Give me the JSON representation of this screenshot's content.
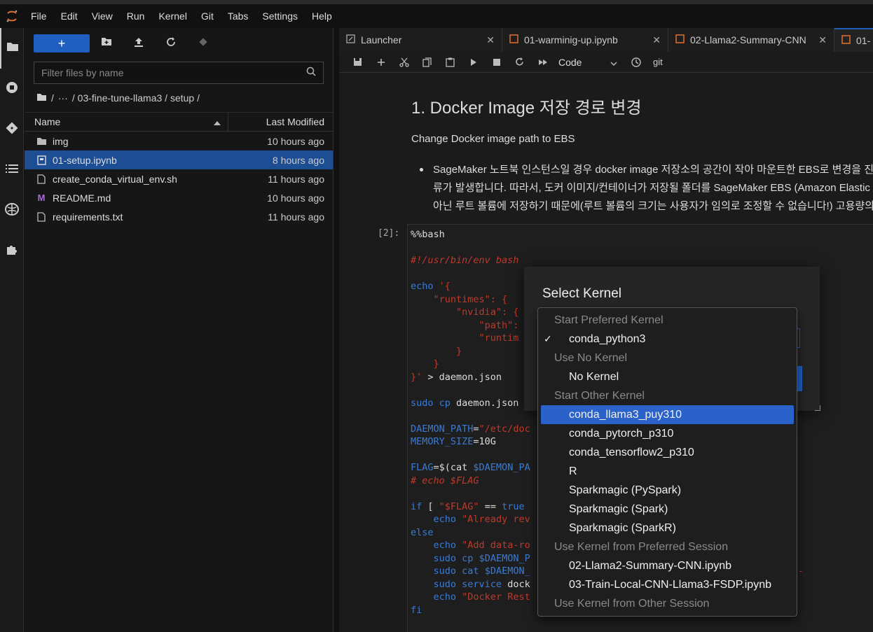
{
  "menubar": {
    "items": [
      "File",
      "Edit",
      "View",
      "Run",
      "Kernel",
      "Git",
      "Tabs",
      "Settings",
      "Help"
    ]
  },
  "filebrowser": {
    "new_label": "+",
    "filter_placeholder": "Filter files by name",
    "breadcrumb": {
      "root": "/",
      "ellipsis": "···",
      "path": "/ 03-fine-tune-llama3 / setup /"
    },
    "columns": {
      "name": "Name",
      "modified": "Last Modified"
    },
    "files": [
      {
        "name": "img",
        "modified": "10 hours ago",
        "icon": "folder-icon"
      },
      {
        "name": "01-setup.ipynb",
        "modified": "8 hours ago",
        "icon": "notebook-icon",
        "selected": true
      },
      {
        "name": "create_conda_virtual_env.sh",
        "modified": "11 hours ago",
        "icon": "file-icon"
      },
      {
        "name": "README.md",
        "modified": "10 hours ago",
        "icon": "markdown-icon"
      },
      {
        "name": "requirements.txt",
        "modified": "11 hours ago",
        "icon": "file-icon"
      }
    ]
  },
  "tabs": [
    {
      "label": "Launcher"
    },
    {
      "label": "01-warminig-up.ipynb"
    },
    {
      "label": "02-Llama2-Summary-CNN"
    },
    {
      "label": "01-"
    }
  ],
  "notebook": {
    "cell_type": "Code",
    "git_label": "git",
    "title": "1. Docker Image 저장 경로 변경",
    "subtitle": "Change Docker image path to EBS",
    "bullet_lines": [
      "SageMaker 노트북 인스턴스일 경우 docker image 저장소의 공간이 작아 마운트한 EBS로 변경을 진행",
      "류가 발생합니다. 따라서, 도커 이미지/컨테이너가 저장될 폴더를 SageMaker EBS (Amazon Elastic B",
      "아닌 루트 볼륨에 저장하기 때문에(루트 볼륨의 크기는 사용자가 임의로 조정할 수 없습니다!) 고용량의 이"
    ],
    "prompt": "[2]:"
  },
  "dialog": {
    "title": "Select Kernel"
  },
  "kernel_dropdown": {
    "groups": [
      {
        "label": "Start Preferred Kernel",
        "options": [
          {
            "label": "conda_python3",
            "checked": true
          }
        ]
      },
      {
        "label": "Use No Kernel",
        "options": [
          {
            "label": "No Kernel"
          }
        ]
      },
      {
        "label": "Start Other Kernel",
        "options": [
          {
            "label": "conda_llama3_puy310",
            "highlighted": true
          },
          {
            "label": "conda_pytorch_p310"
          },
          {
            "label": "conda_tensorflow2_p310"
          },
          {
            "label": "R"
          },
          {
            "label": "Sparkmagic (PySpark)"
          },
          {
            "label": "Sparkmagic (Spark)"
          },
          {
            "label": "Sparkmagic (SparkR)"
          }
        ]
      },
      {
        "label": "Use Kernel from Preferred Session",
        "options": [
          {
            "label": "02-Llama2-Summary-CNN.ipynb"
          },
          {
            "label": "03-Train-Local-CNN-Llama3-FSDP.ipynb"
          }
        ]
      },
      {
        "label": "Use Kernel from Other Session",
        "options": []
      }
    ],
    "check_glyph": "✓"
  }
}
